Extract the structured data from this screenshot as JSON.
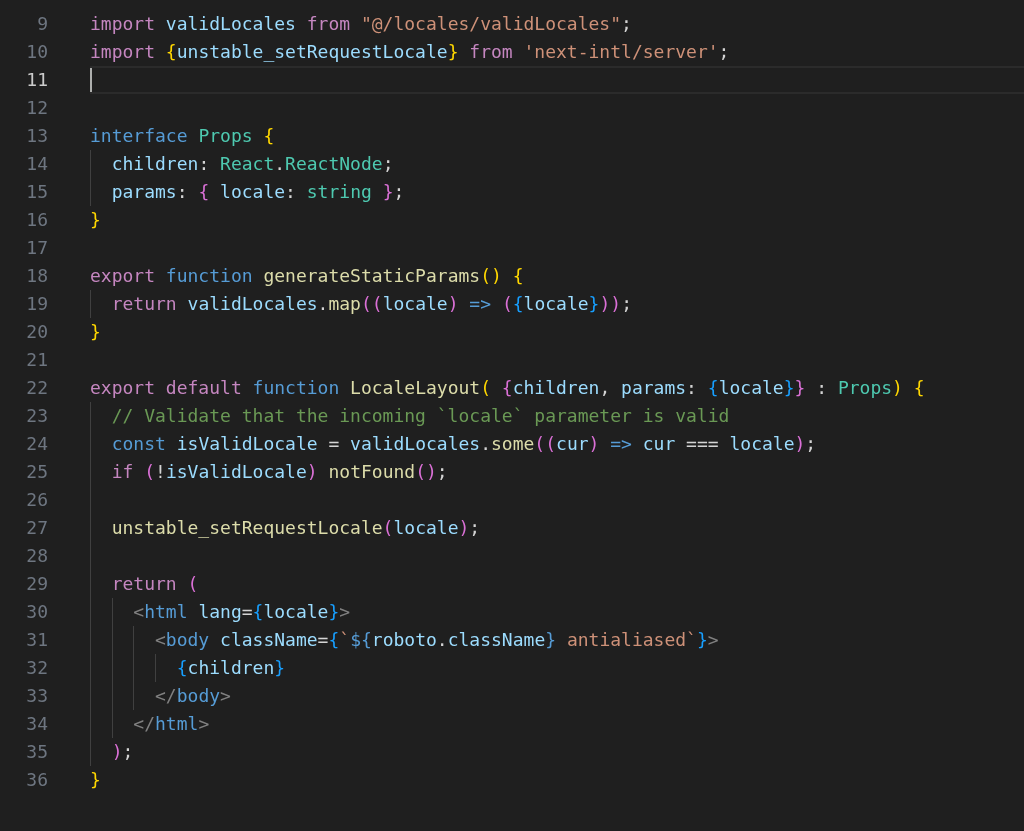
{
  "editor": {
    "lines": [
      {
        "number": "9",
        "current": false,
        "tokens": [
          {
            "text": "import ",
            "kind": "kw"
          },
          {
            "text": "validLocales ",
            "kind": "var"
          },
          {
            "text": "from ",
            "kind": "kw"
          },
          {
            "text": "\"@/locales/validLocales\"",
            "kind": "str"
          },
          {
            "text": ";",
            "kind": "p"
          }
        ]
      },
      {
        "number": "10",
        "current": false,
        "tokens": [
          {
            "text": "import ",
            "kind": "kw"
          },
          {
            "text": "{",
            "kind": "b1"
          },
          {
            "text": "unstable_setRequestLocale",
            "kind": "var"
          },
          {
            "text": "}",
            "kind": "b1"
          },
          {
            "text": " from ",
            "kind": "kw"
          },
          {
            "text": "'next-intl/server'",
            "kind": "str"
          },
          {
            "text": ";",
            "kind": "p"
          }
        ]
      },
      {
        "number": "11",
        "current": true
      },
      {
        "number": "12",
        "current": false
      },
      {
        "number": "13",
        "current": false,
        "tokens": [
          {
            "text": "interface ",
            "kind": "storage"
          },
          {
            "text": "Props ",
            "kind": "type"
          },
          {
            "text": "{",
            "kind": "b1"
          }
        ]
      },
      {
        "number": "14",
        "current": false,
        "tokens": [
          {
            "text": "  children",
            "kind": "var"
          },
          {
            "text": ": ",
            "kind": "p"
          },
          {
            "text": "React",
            "kind": "type"
          },
          {
            "text": ".",
            "kind": "p"
          },
          {
            "text": "ReactNode",
            "kind": "type"
          },
          {
            "text": ";",
            "kind": "p"
          }
        ]
      },
      {
        "number": "15",
        "current": false,
        "tokens": [
          {
            "text": "  params",
            "kind": "var"
          },
          {
            "text": ": ",
            "kind": "p"
          },
          {
            "text": "{",
            "kind": "b2"
          },
          {
            "text": " locale",
            "kind": "var"
          },
          {
            "text": ": ",
            "kind": "p"
          },
          {
            "text": "string ",
            "kind": "type"
          },
          {
            "text": "}",
            "kind": "b2"
          },
          {
            "text": ";",
            "kind": "p"
          }
        ]
      },
      {
        "number": "16",
        "current": false,
        "tokens": [
          {
            "text": "}",
            "kind": "b1"
          }
        ]
      },
      {
        "number": "17",
        "current": false
      },
      {
        "number": "18",
        "current": false,
        "tokens": [
          {
            "text": "export ",
            "kind": "kw"
          },
          {
            "text": "function ",
            "kind": "storage"
          },
          {
            "text": "generateStaticParams",
            "kind": "fn"
          },
          {
            "text": "() ",
            "kind": "b1"
          },
          {
            "text": "{",
            "kind": "b1"
          }
        ]
      },
      {
        "number": "19",
        "current": false,
        "tokens": [
          {
            "text": "  return ",
            "kind": "kw"
          },
          {
            "text": "validLocales",
            "kind": "var"
          },
          {
            "text": ".",
            "kind": "p"
          },
          {
            "text": "map",
            "kind": "fn"
          },
          {
            "text": "((",
            "kind": "b2"
          },
          {
            "text": "locale",
            "kind": "var"
          },
          {
            "text": ")",
            "kind": "b2"
          },
          {
            "text": " => ",
            "kind": "storage"
          },
          {
            "text": "(",
            "kind": "b2"
          },
          {
            "text": "{",
            "kind": "b3"
          },
          {
            "text": "locale",
            "kind": "var"
          },
          {
            "text": "}",
            "kind": "b3"
          },
          {
            "text": "))",
            "kind": "b2"
          },
          {
            "text": ";",
            "kind": "p"
          }
        ]
      },
      {
        "number": "20",
        "current": false,
        "tokens": [
          {
            "text": "}",
            "kind": "b1"
          }
        ]
      },
      {
        "number": "21",
        "current": false
      },
      {
        "number": "22",
        "current": false,
        "tokens": [
          {
            "text": "export default ",
            "kind": "kw"
          },
          {
            "text": "function ",
            "kind": "storage"
          },
          {
            "text": "LocaleLayout",
            "kind": "fn"
          },
          {
            "text": "( ",
            "kind": "b1"
          },
          {
            "text": "{",
            "kind": "b2"
          },
          {
            "text": "children",
            "kind": "var"
          },
          {
            "text": ", ",
            "kind": "p"
          },
          {
            "text": "params",
            "kind": "var"
          },
          {
            "text": ": ",
            "kind": "p"
          },
          {
            "text": "{",
            "kind": "b3"
          },
          {
            "text": "locale",
            "kind": "var"
          },
          {
            "text": "}",
            "kind": "b3"
          },
          {
            "text": "}",
            "kind": "b2"
          },
          {
            "text": " : ",
            "kind": "p"
          },
          {
            "text": "Props",
            "kind": "type"
          },
          {
            "text": ") ",
            "kind": "b1"
          },
          {
            "text": "{",
            "kind": "b1"
          }
        ]
      },
      {
        "number": "23",
        "current": false,
        "tokens": [
          {
            "text": "  // Validate that the incoming `locale` parameter is valid",
            "kind": "comment"
          }
        ]
      },
      {
        "number": "24",
        "current": false,
        "tokens": [
          {
            "text": "  const ",
            "kind": "storage"
          },
          {
            "text": "isValidLocale",
            "kind": "var"
          },
          {
            "text": " = ",
            "kind": "p"
          },
          {
            "text": "validLocales",
            "kind": "var"
          },
          {
            "text": ".",
            "kind": "p"
          },
          {
            "text": "some",
            "kind": "fn"
          },
          {
            "text": "((",
            "kind": "b2"
          },
          {
            "text": "cur",
            "kind": "var"
          },
          {
            "text": ")",
            "kind": "b2"
          },
          {
            "text": " => ",
            "kind": "storage"
          },
          {
            "text": "cur",
            "kind": "var"
          },
          {
            "text": " === ",
            "kind": "p"
          },
          {
            "text": "locale",
            "kind": "var"
          },
          {
            "text": ")",
            "kind": "b2"
          },
          {
            "text": ";",
            "kind": "p"
          }
        ]
      },
      {
        "number": "25",
        "current": false,
        "tokens": [
          {
            "text": "  if ",
            "kind": "kw"
          },
          {
            "text": "(",
            "kind": "b2"
          },
          {
            "text": "!",
            "kind": "p"
          },
          {
            "text": "isValidLocale",
            "kind": "var"
          },
          {
            "text": ") ",
            "kind": "b2"
          },
          {
            "text": "notFound",
            "kind": "fn"
          },
          {
            "text": "()",
            "kind": "b2"
          },
          {
            "text": ";",
            "kind": "p"
          }
        ]
      },
      {
        "number": "26",
        "current": false
      },
      {
        "number": "27",
        "current": false,
        "tokens": [
          {
            "text": "  unstable_setRequestLocale",
            "kind": "fn"
          },
          {
            "text": "(",
            "kind": "b2"
          },
          {
            "text": "locale",
            "kind": "var"
          },
          {
            "text": ")",
            "kind": "b2"
          },
          {
            "text": ";",
            "kind": "p"
          }
        ]
      },
      {
        "number": "28",
        "current": false
      },
      {
        "number": "29",
        "current": false,
        "tokens": [
          {
            "text": "  return ",
            "kind": "kw"
          },
          {
            "text": "(",
            "kind": "b2"
          }
        ]
      },
      {
        "number": "30",
        "current": false,
        "tokens": [
          {
            "text": "    <",
            "kind": "angle"
          },
          {
            "text": "html",
            "kind": "tag"
          },
          {
            "text": " lang",
            "kind": "var"
          },
          {
            "text": "=",
            "kind": "p"
          },
          {
            "text": "{",
            "kind": "b3"
          },
          {
            "text": "locale",
            "kind": "var"
          },
          {
            "text": "}",
            "kind": "b3"
          },
          {
            "text": ">",
            "kind": "angle"
          }
        ]
      },
      {
        "number": "31",
        "current": false,
        "tokens": [
          {
            "text": "      <",
            "kind": "angle"
          },
          {
            "text": "body",
            "kind": "tag"
          },
          {
            "text": " className",
            "kind": "var"
          },
          {
            "text": "=",
            "kind": "p"
          },
          {
            "text": "{",
            "kind": "b3"
          },
          {
            "text": "`",
            "kind": "str"
          },
          {
            "text": "${",
            "kind": "storage"
          },
          {
            "text": "roboto",
            "kind": "var"
          },
          {
            "text": ".",
            "kind": "p"
          },
          {
            "text": "className",
            "kind": "var"
          },
          {
            "text": "}",
            "kind": "storage"
          },
          {
            "text": " antialiased`",
            "kind": "str"
          },
          {
            "text": "}",
            "kind": "b3"
          },
          {
            "text": ">",
            "kind": "angle"
          }
        ]
      },
      {
        "number": "32",
        "current": false,
        "tokens": [
          {
            "text": "        {",
            "kind": "b3"
          },
          {
            "text": "children",
            "kind": "var"
          },
          {
            "text": "}",
            "kind": "b3"
          }
        ]
      },
      {
        "number": "33",
        "current": false,
        "tokens": [
          {
            "text": "      </",
            "kind": "angle"
          },
          {
            "text": "body",
            "kind": "tag"
          },
          {
            "text": ">",
            "kind": "angle"
          }
        ]
      },
      {
        "number": "34",
        "current": false,
        "tokens": [
          {
            "text": "    </",
            "kind": "angle"
          },
          {
            "text": "html",
            "kind": "tag"
          },
          {
            "text": ">",
            "kind": "angle"
          }
        ]
      },
      {
        "number": "35",
        "current": false,
        "tokens": [
          {
            "text": "  )",
            "kind": "b2"
          },
          {
            "text": ";",
            "kind": "p"
          }
        ]
      },
      {
        "number": "36",
        "current": false,
        "tokens": [
          {
            "text": "}",
            "kind": "b1"
          }
        ]
      }
    ]
  }
}
